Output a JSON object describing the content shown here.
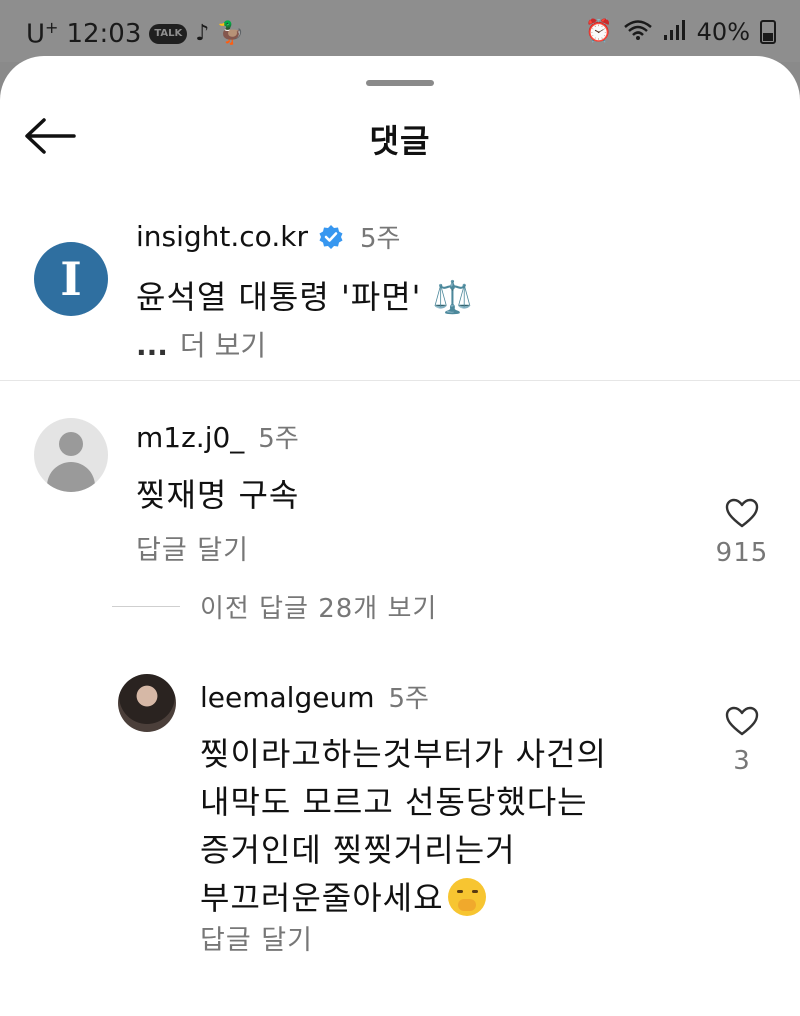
{
  "status_bar": {
    "carrier": "U",
    "carrier_sup": "+",
    "time": "12:03",
    "talk_label": "TALK",
    "battery": "40%"
  },
  "sheet": {
    "title": "댓글"
  },
  "caption": {
    "avatar_letter": "I",
    "username": "insight.co.kr",
    "time": "5주",
    "text": "윤석열 대통령 '파면' ⚖️",
    "ellipsis": "...",
    "more": "더 보기"
  },
  "comments": [
    {
      "username": "m1z.j0_",
      "time": "5주",
      "text": "찢재명 구속",
      "reply_label": "답글 달기",
      "likes": "915"
    }
  ],
  "view_replies": "이전 답글 28개 보기",
  "replies": [
    {
      "username": "leemalgeum",
      "time": "5주",
      "lines": [
        "찢이라고하는것부터가 사건의",
        "내막도 모르고 선동당했다는",
        "증거인데 찢찢거리는거",
        "부끄러운줄아세요"
      ],
      "reply_label": "답글 달기",
      "likes": "3"
    }
  ],
  "colors": {
    "verified": "#3797f0",
    "avatar_insight": "#2f6fa0",
    "muted_text": "#777777"
  }
}
